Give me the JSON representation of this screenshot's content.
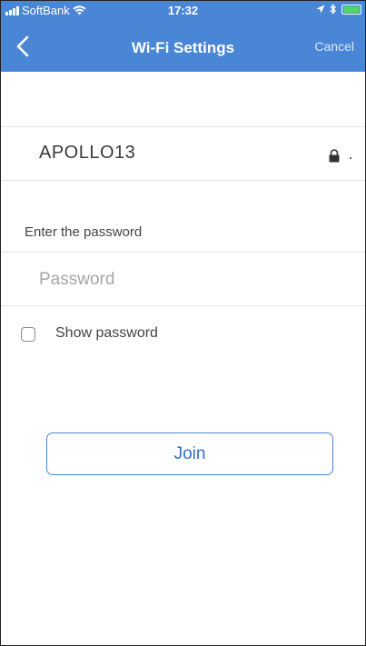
{
  "status_bar": {
    "carrier": "SoftBank",
    "time": "17:32",
    "wifi_icon": "wifi-icon",
    "location_icon": "location-arrow-icon",
    "bluetooth_icon": "bluetooth-icon",
    "battery_color": "#4cd964"
  },
  "nav": {
    "back_icon": "chevron-left-icon",
    "title": "Wi-Fi Settings",
    "cancel_label": "Cancel",
    "background_color": "#4a86d6"
  },
  "network": {
    "ssid": "APOLLO13",
    "secured_icon": "lock-icon"
  },
  "password": {
    "section_label": "Enter the password",
    "placeholder": "Password",
    "value": ""
  },
  "show_password": {
    "label": "Show password",
    "checked": false
  },
  "join_label": "Join"
}
